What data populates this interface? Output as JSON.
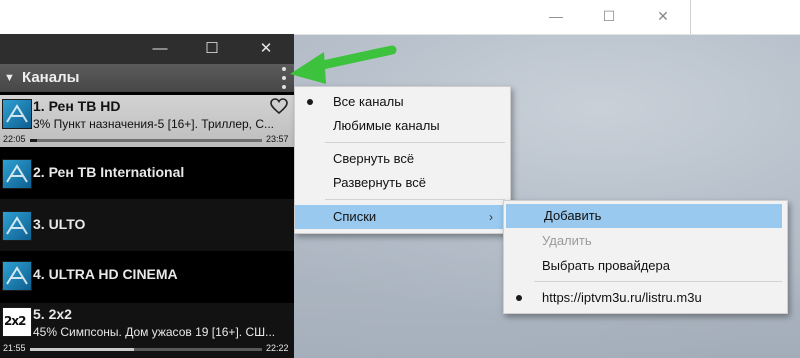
{
  "top_window": {
    "controls": {
      "minimize": "—",
      "maximize": "☐",
      "close": "✕"
    }
  },
  "player": {
    "window_controls": {
      "minimize": "—",
      "maximize": "☐",
      "close": "✕"
    },
    "header_title": "Каналы",
    "channels": [
      {
        "name": "1. Рен ТВ HD",
        "program": "3% Пункт назначения-5 [16+]. Триллер, С...",
        "start": "22:05",
        "end": "23:57",
        "progress": 0.03,
        "favorite": true,
        "selected": true,
        "logo": "ren-tv-logo"
      },
      {
        "name": "2. Рен ТВ International",
        "logo": "ren-tv-logo"
      },
      {
        "name": "3. ULTO",
        "logo": "ren-tv-logo"
      },
      {
        "name": "4. ULTRA HD CINEMA",
        "logo": "ren-tv-logo"
      },
      {
        "name": "5. 2x2",
        "program": "45% Симпсоны. Дом ужасов 19 [16+]. СШ...",
        "start": "21:55",
        "end": "22:22",
        "progress": 0.45,
        "logo": "2x2-logo",
        "logo_text": "2x2"
      }
    ]
  },
  "context_menu": {
    "items": [
      {
        "label": "Все каналы",
        "checked": true
      },
      {
        "label": "Любимые каналы"
      },
      {
        "label": "Свернуть всё"
      },
      {
        "label": "Развернуть всё"
      },
      {
        "label": "Списки",
        "has_submenu": true,
        "highlighted": true
      }
    ],
    "submenu_arrow": "›"
  },
  "submenu": {
    "items": [
      {
        "label": "Добавить",
        "highlighted": true
      },
      {
        "label": "Удалить",
        "disabled": true
      },
      {
        "label": "Выбрать провайдера"
      },
      {
        "label": "https://iptvm3u.ru/listru.m3u",
        "checked": true
      }
    ]
  },
  "colors": {
    "menu_highlight": "#99c9ef",
    "arrow_green": "#3cc23c",
    "logo_blue": "#2fa0d3"
  }
}
